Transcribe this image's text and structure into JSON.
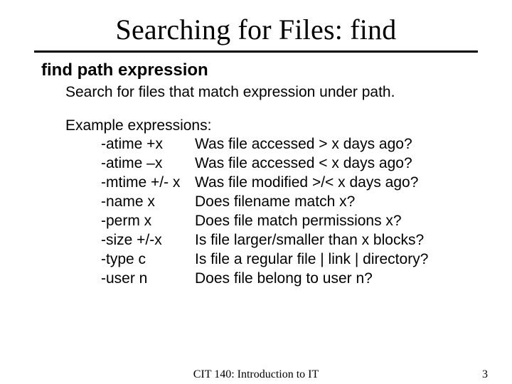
{
  "title": "Searching for Files: find",
  "command": "find path expression",
  "description": "Search for files that match expression under path.",
  "examples_label": "Example expressions:",
  "expressions": [
    {
      "key": "-atime +x",
      "val": "Was file accessed > x days ago?"
    },
    {
      "key": "-atime –x",
      "val": "Was file accessed < x days ago?"
    },
    {
      "key": "-mtime +/- x",
      "val": "Was file modified >/< x days ago?"
    },
    {
      "key": "-name x",
      "val": "Does filename match x?"
    },
    {
      "key": "-perm x",
      "val": "Does file match permissions x?"
    },
    {
      "key": "-size +/-x",
      "val": "Is file larger/smaller than x blocks?"
    },
    {
      "key": "-type c",
      "val": "Is file a regular file | link | directory?"
    },
    {
      "key": "-user n",
      "val": "Does file belong to user n?"
    }
  ],
  "footer": {
    "course": "CIT 140: Introduction to IT",
    "page": "3"
  }
}
